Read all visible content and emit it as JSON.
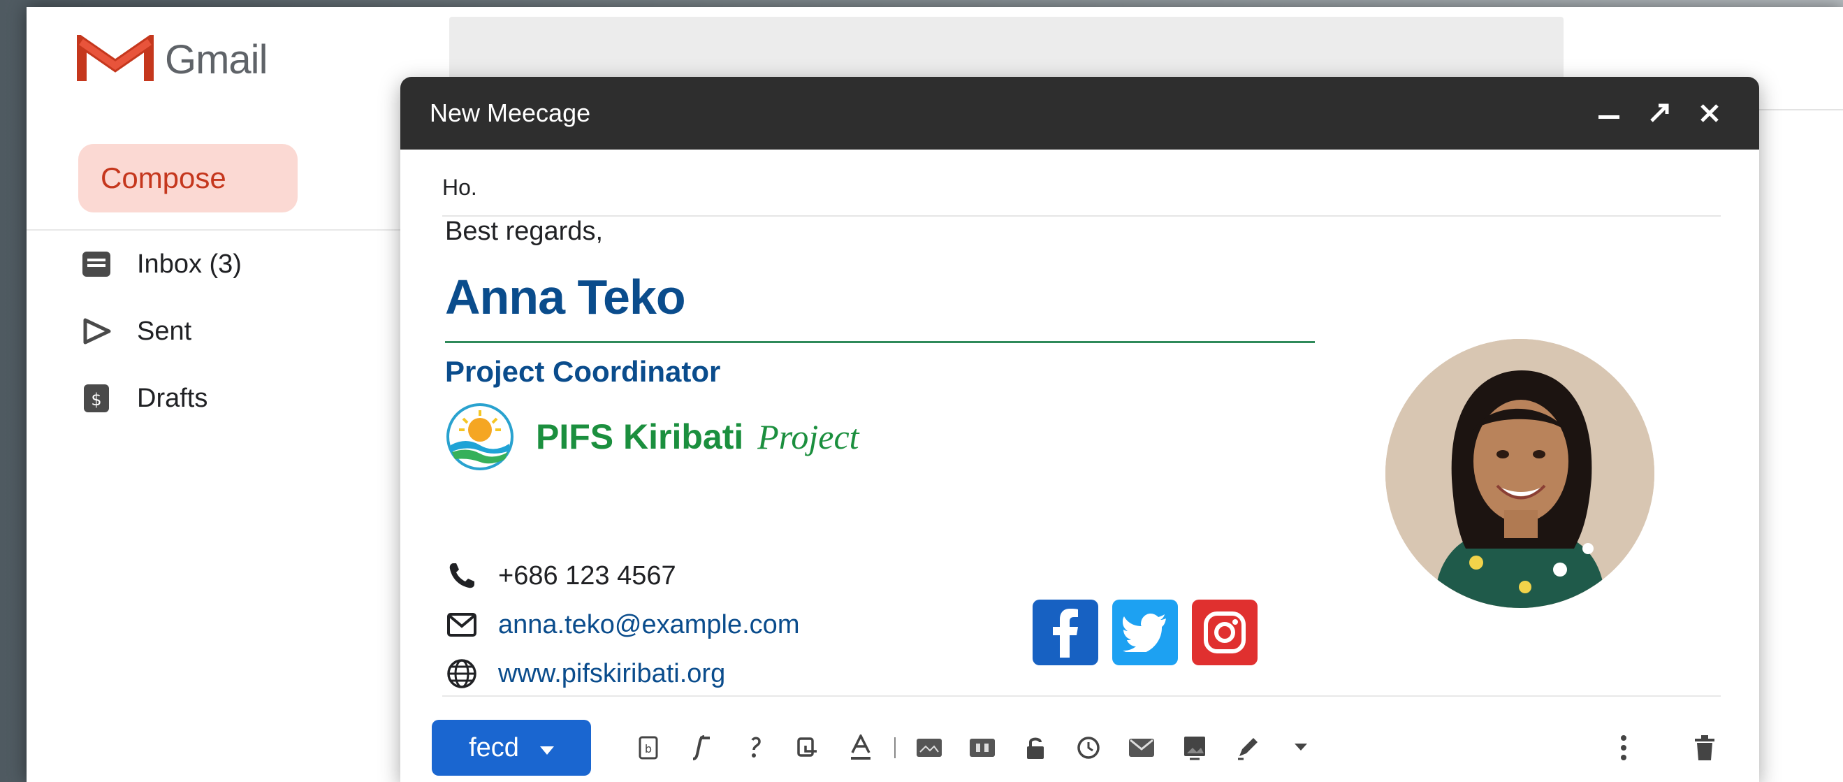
{
  "app": {
    "name": "Gmail"
  },
  "sidebar": {
    "compose_label": "Compose",
    "items": [
      {
        "label": "Inbox (3)",
        "icon": "inbox-icon"
      },
      {
        "label": "Sent",
        "icon": "send-icon"
      },
      {
        "label": "Drafts",
        "icon": "drafts-icon"
      }
    ]
  },
  "compose": {
    "title": "New Meecage",
    "to_value": "Ho.",
    "greeting": "Best regards,",
    "signature": {
      "name": "Anna Teko",
      "title": "Project Coordinator",
      "org_name": "PIFS Kiribati",
      "org_suffix": "Project",
      "phone": "+686 123 4567",
      "email": "anna.teko@example.com",
      "website": "www.pifskiribati.org"
    },
    "send_label": "fecd"
  },
  "colors": {
    "brand_blue": "#0a4c8c",
    "org_green": "#1b8f3e",
    "send_blue": "#1a66d0",
    "compose_pink": "#fbd9d3",
    "compose_text": "#c5371d"
  }
}
